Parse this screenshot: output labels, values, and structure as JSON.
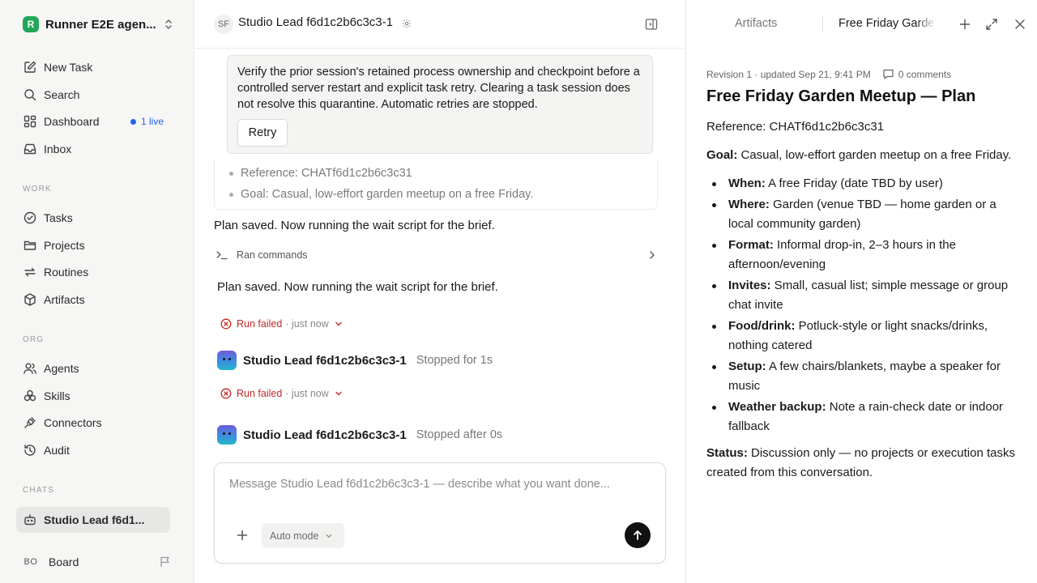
{
  "workspace": {
    "logo_letter": "R",
    "name": "Runner E2E agen..."
  },
  "nav": {
    "new_task": "New Task",
    "search": "Search",
    "dashboard": "Dashboard",
    "dashboard_live": "1 live",
    "inbox": "Inbox"
  },
  "sections": {
    "work": "WORK",
    "org": "ORG",
    "chats": "CHATS"
  },
  "work_items": {
    "tasks": "Tasks",
    "projects": "Projects",
    "routines": "Routines",
    "artifacts": "Artifacts"
  },
  "org_items": {
    "agents": "Agents",
    "skills": "Skills",
    "connectors": "Connectors",
    "audit": "Audit"
  },
  "chats": {
    "current": "Studio Lead f6d1..."
  },
  "user": {
    "initials": "BO",
    "name": "Board"
  },
  "header": {
    "avatar": "SF",
    "title": "Studio Lead f6d1c2b6c3c3-1"
  },
  "error_card": {
    "text": "Verify the prior session's retained process ownership and checkpoint before a controlled server restart and explicit task retry. Clearing a task session does not resolve this quarantine. Automatic retries are stopped.",
    "retry_label": "Retry"
  },
  "ref_card": {
    "items": [
      "Reference: CHATf6d1c2b6c3c31",
      "Goal: Casual, low-effort garden meetup on a free Friday."
    ]
  },
  "messages": {
    "plan_saved_1": "Plan saved. Now running the wait script for the brief.",
    "ran_commands": "Ran commands",
    "plan_saved_2": "Plan saved. Now running the wait script for the brief."
  },
  "runs": [
    {
      "status": "Run failed",
      "time": "· just now",
      "agent": "Studio Lead f6d1c2b6c3c3-1",
      "result": "Stopped for 1s"
    },
    {
      "status": "Run failed",
      "time": "· just now",
      "agent": "Studio Lead f6d1c2b6c3c3-1",
      "result": "Stopped after 0s"
    }
  ],
  "composer": {
    "placeholder": "Message Studio Lead f6d1c2b6c3c3-1 — describe what you want done...",
    "mode": "Auto mode"
  },
  "artifact_panel": {
    "tab_artifacts": "Artifacts",
    "tab_active": "Free Friday Garden Meetup — Plan",
    "meta": "Revision 1 · updated Sep 21, 9:41 PM",
    "comments": "0 comments",
    "title": "Free Friday Garden Meetup — Plan",
    "reference": "Reference: CHATf6d1c2b6c3c31",
    "goal_label": "Goal:",
    "goal_text": " Casual, low-effort garden meetup on a free Friday.",
    "bullets": [
      {
        "label": "When:",
        "text": " A free Friday (date TBD by user)"
      },
      {
        "label": "Where:",
        "text": " Garden (venue TBD — home garden or a local community garden)"
      },
      {
        "label": "Format:",
        "text": " Informal drop-in, 2–3 hours in the afternoon/evening"
      },
      {
        "label": "Invites:",
        "text": " Small, casual list; simple message or group chat invite"
      },
      {
        "label": "Food/drink:",
        "text": " Potluck-style or light snacks/drinks, nothing catered"
      },
      {
        "label": "Setup:",
        "text": " A few chairs/blankets, maybe a speaker for music"
      },
      {
        "label": "Weather backup:",
        "text": " Note a rain-check date or indoor fallback"
      }
    ],
    "status_label": "Status:",
    "status_text": " Discussion only — no projects or execution tasks created from this conversation."
  },
  "colors": {
    "accent_blue": "#2563eb",
    "error_red": "#c62828",
    "brand_green": "#22a75a"
  }
}
